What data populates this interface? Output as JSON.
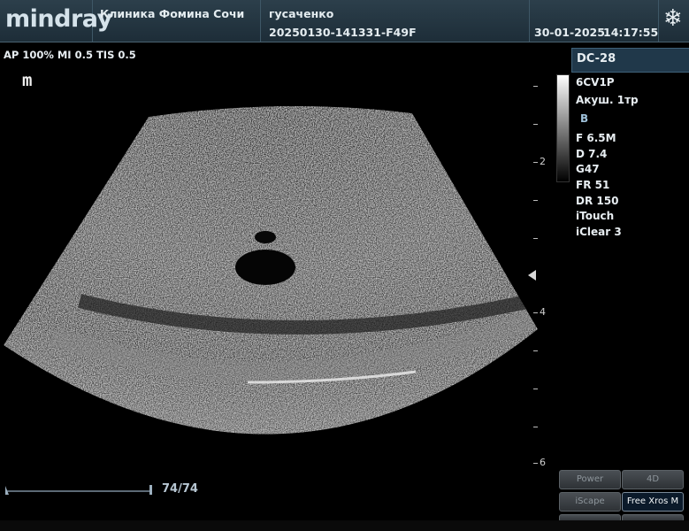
{
  "header": {
    "logo": "mindray",
    "clinic": "Клиника Фомина Сочи",
    "patient_name": "гусаченко",
    "exam_id": "20250130-141331-F49F",
    "date": "30-01-2025",
    "time": "14:17:55",
    "freeze_icon": "snowflake-icon"
  },
  "scan_params": "AP 100%  MI 0.5  TIS 0.5",
  "orientation_marker": "m",
  "system": "DC-28",
  "params": [
    "6CV1P",
    "Акуш. 1тр",
    "B",
    "F 6.5M",
    "D 7.4",
    "G47",
    "FR 51",
    "DR 150",
    "iTouch",
    "iClear 3"
  ],
  "depth_labels": [
    "2",
    "4",
    "6"
  ],
  "cine": {
    "counter": "74/74"
  },
  "soft_buttons": [
    {
      "label": "Power",
      "active": false
    },
    {
      "label": "4D",
      "active": false
    },
    {
      "label": "iScape",
      "active": false
    },
    {
      "label": "Free Xros M",
      "active": true
    }
  ]
}
